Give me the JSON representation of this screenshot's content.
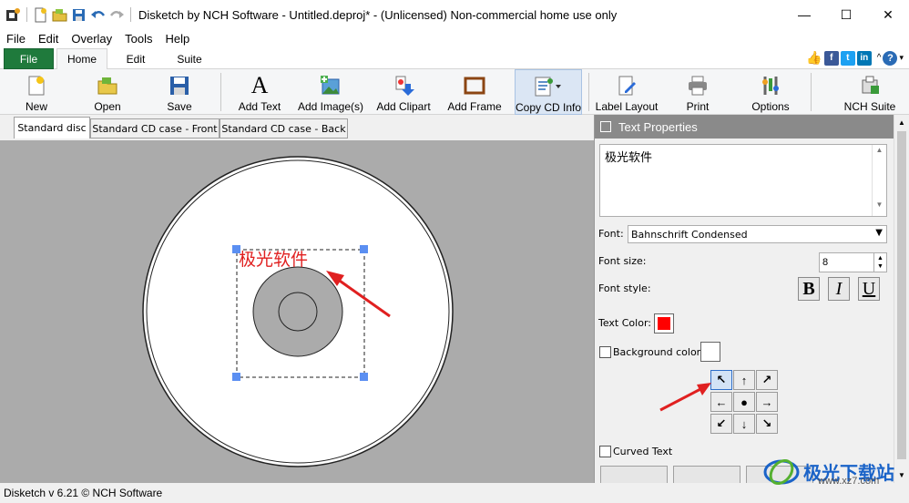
{
  "window": {
    "title": "Disketch by NCH Software - Untitled.deproj* - (Unlicensed) Non-commercial home use only",
    "minimize": "—",
    "maximize": "☐",
    "close": "✕"
  },
  "menu": [
    "File",
    "Edit",
    "Overlay",
    "Tools",
    "Help"
  ],
  "ribbon_tabs": [
    "File",
    "Home",
    "Edit",
    "Suite"
  ],
  "ribbon_buttons": {
    "new": "New",
    "open": "Open",
    "save": "Save",
    "add_text": "Add Text",
    "add_images": "Add Image(s)",
    "add_clipart": "Add Clipart",
    "add_frame": "Add Frame",
    "copy_cd_info": "Copy CD Info",
    "label_layout": "Label Layout",
    "print": "Print",
    "options": "Options",
    "nch_suite": "NCH Suite"
  },
  "doc_tabs": [
    "Standard disc",
    "Standard CD case - Front",
    "Standard CD case - Back"
  ],
  "canvas": {
    "text_object": "极光软件"
  },
  "panel": {
    "title": "Text Properties",
    "text_value": "极光软件",
    "font_label": "Font:",
    "font_value": "Bahnschrift Condensed",
    "size_label": "Font size:",
    "size_value": "8",
    "style_label": "Font style:",
    "bold": "B",
    "italic": "I",
    "underline": "U",
    "text_color_label": "Text Color:",
    "text_color": "#ff0000",
    "bg_color_label": "Background color:",
    "curved_label": "Curved Text"
  },
  "status": "Disketch v 6.21 © NCH Software",
  "watermark": {
    "text": "极光下载站",
    "url": "www.xz7.com"
  },
  "colors": {
    "file_tab": "#1f7a3c",
    "panel_header": "#8a8a8a",
    "selection_handle": "#5b8ff2",
    "arrow": "#e02020"
  }
}
